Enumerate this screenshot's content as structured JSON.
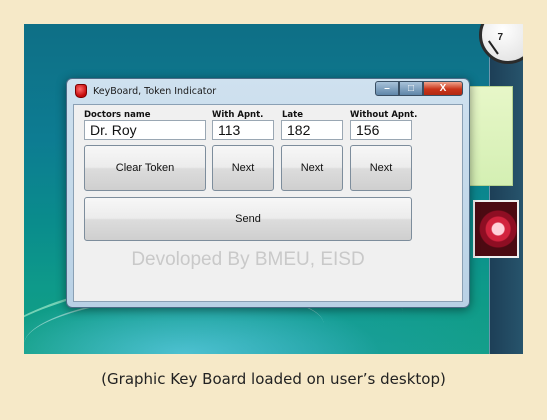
{
  "window": {
    "title": "KeyBoard, Token Indicator",
    "controls": {
      "minimize": "–",
      "maximize": "□",
      "close": "X"
    }
  },
  "columns": {
    "doctor": {
      "label": "Doctors name",
      "value": "Dr. Roy"
    },
    "with_apnt": {
      "label": "With Apnt.",
      "value": "113"
    },
    "late": {
      "label": "Late",
      "value": "182"
    },
    "without_apnt": {
      "label": "Without Apnt.",
      "value": "156"
    }
  },
  "buttons": {
    "clear_token": "Clear Token",
    "next_with_apnt": "Next",
    "next_late": "Next",
    "next_without_apnt": "Next",
    "send": "Send"
  },
  "footer": "Devoloped By BMEU, EISD",
  "desktop": {
    "clock_number": "7"
  },
  "caption": "(Graphic Key Board loaded on user’s desktop)",
  "colors": {
    "page_background": "#f6e9c8",
    "desktop_teal": "#0d7c92",
    "close_button_red": "#c9341a",
    "app_icon_red": "#c40a0a"
  }
}
